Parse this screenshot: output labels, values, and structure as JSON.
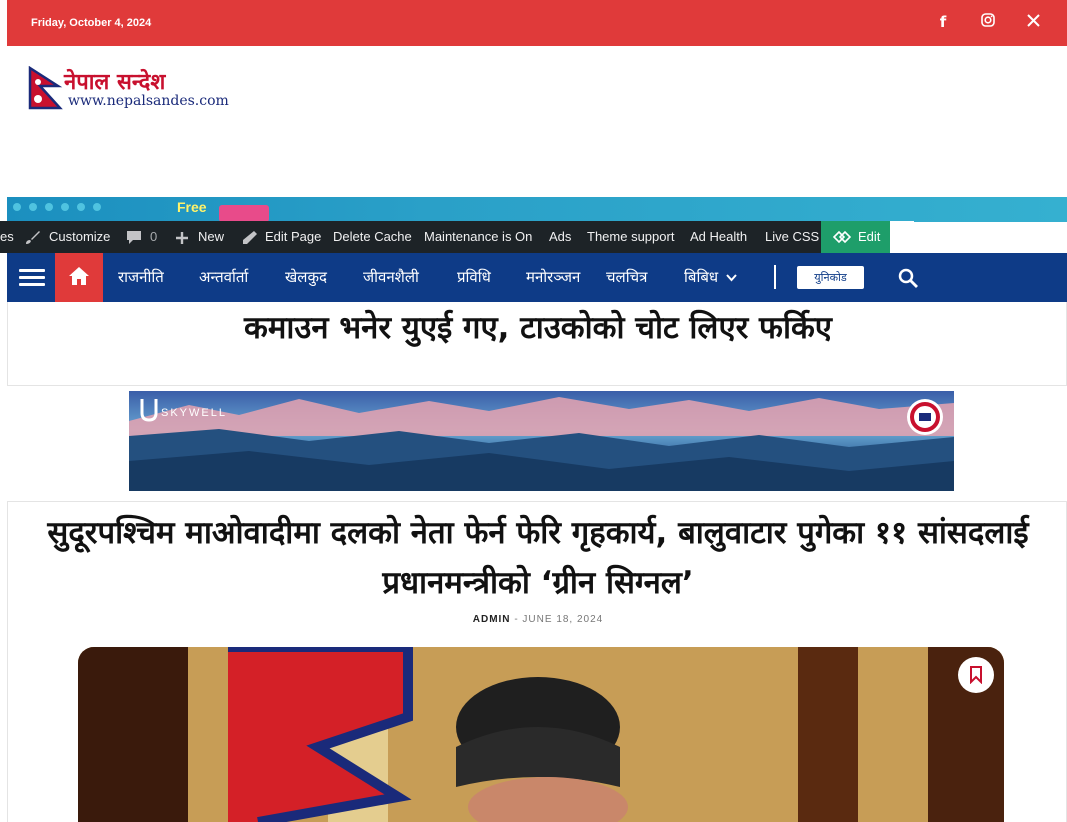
{
  "topbar": {
    "date": "Friday, October 4, 2024",
    "social": [
      {
        "name": "facebook-icon",
        "glyph": "f"
      },
      {
        "name": "instagram-icon",
        "glyph": "◎"
      },
      {
        "name": "x-icon",
        "glyph": "X"
      }
    ]
  },
  "logo": {
    "name": "नेपाल सन्देश",
    "url": "www.nepalsandes.com"
  },
  "banner_top": {
    "text": "Free"
  },
  "adminbar": {
    "items": [
      "es",
      "Customize",
      "0",
      "New",
      "Edit Page",
      "Delete Cache",
      "Maintenance is On",
      "Ads",
      "Theme support",
      "Ad Health",
      "Live CSS"
    ],
    "edit_label": "Edit"
  },
  "nav": {
    "items": [
      "राजनीति",
      "अन्तर्वार्ता",
      "खेलकुद",
      "जीवनशैली",
      "प्रविधि",
      "मनोरञ्जन",
      "चलचित्र",
      "बिबिध"
    ],
    "unicode_label": "युनिकोड"
  },
  "headline": {
    "text": "कमाउन भनेर युएई गए, टाउकोको चोट लिएर फर्किए"
  },
  "ad": {
    "brand": "SKYWELL"
  },
  "article": {
    "title": "सुदूरपश्चिम माओवादीमा दलको नेता फेर्न फेरि गृहकार्य, बालुवाटार पुगेका ११ सांसदलाई प्रधानमन्त्रीको ‘ग्रीन सिग्नल’",
    "author": "ADMIN",
    "date": "JUNE 18, 2024"
  },
  "colors": {
    "topbar": "#e03a3a",
    "navbar": "#0e3b87",
    "adminbar": "#1d2327",
    "edit_button": "#1e9e6a"
  }
}
